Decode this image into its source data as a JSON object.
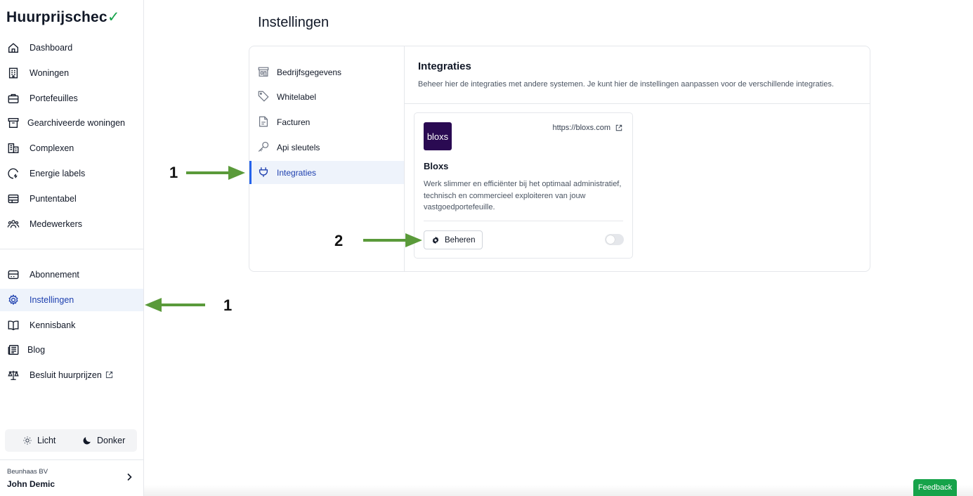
{
  "app": {
    "logo_text": "Huurprijschec",
    "logo_mark": "✓"
  },
  "sidebar": {
    "primary_items": [
      {
        "label": "Dashboard",
        "icon": "home-icon"
      },
      {
        "label": "Woningen",
        "icon": "building-icon"
      },
      {
        "label": "Portefeuilles",
        "icon": "briefcase-icon"
      },
      {
        "label": "Gearchiveerde woningen",
        "icon": "archive-icon"
      },
      {
        "label": "Complexen",
        "icon": "buildings-icon"
      },
      {
        "label": "Energie labels",
        "icon": "energy-icon"
      },
      {
        "label": "Puntentabel",
        "icon": "table-icon"
      },
      {
        "label": "Medewerkers",
        "icon": "users-icon"
      }
    ],
    "secondary_items": [
      {
        "label": "Abonnement",
        "icon": "credit-card-icon"
      },
      {
        "label": "Instellingen",
        "icon": "gear-icon",
        "active": true
      },
      {
        "label": "Kennisbank",
        "icon": "book-icon"
      },
      {
        "label": "Blog",
        "icon": "newspaper-icon"
      },
      {
        "label": "Besluit huurprijzen",
        "icon": "scale-icon",
        "external": true
      }
    ],
    "theme": {
      "light_label": "Licht",
      "dark_label": "Donker"
    },
    "user": {
      "company": "Beunhaas BV",
      "name": "John Demic"
    }
  },
  "main": {
    "page_title": "Instellingen",
    "settings_nav": [
      {
        "label": "Bedrijfsgegevens",
        "icon": "store-icon"
      },
      {
        "label": "Whitelabel",
        "icon": "tag-icon"
      },
      {
        "label": "Facturen",
        "icon": "document-icon"
      },
      {
        "label": "Api sleutels",
        "icon": "key-icon"
      },
      {
        "label": "Integraties",
        "icon": "plug-icon",
        "active": true
      }
    ],
    "section": {
      "title": "Integraties",
      "description": "Beheer hier de integraties met andere systemen. Je kunt hier de instellingen aanpassen voor de verschillende integraties."
    },
    "integration_card": {
      "logo_text": "bloxs",
      "url": "https://bloxs.com",
      "name": "Bloxs",
      "description": "Werk slimmer en efficiënter bij het optimaal administratief, technisch en commercieel exploiteren van jouw vastgoedportefeuille.",
      "manage_label": "Beheren",
      "enabled": false
    }
  },
  "annotations": {
    "step_1a": "1",
    "step_1b": "1",
    "step_2": "2"
  },
  "feedback_label": "Feedback",
  "colors": {
    "accent": "#2563eb",
    "active_bg": "#eef3fb",
    "brand_green": "#16a34a",
    "bloxs_purple": "#2a0a52",
    "arrow_green": "#5a9a3a"
  }
}
